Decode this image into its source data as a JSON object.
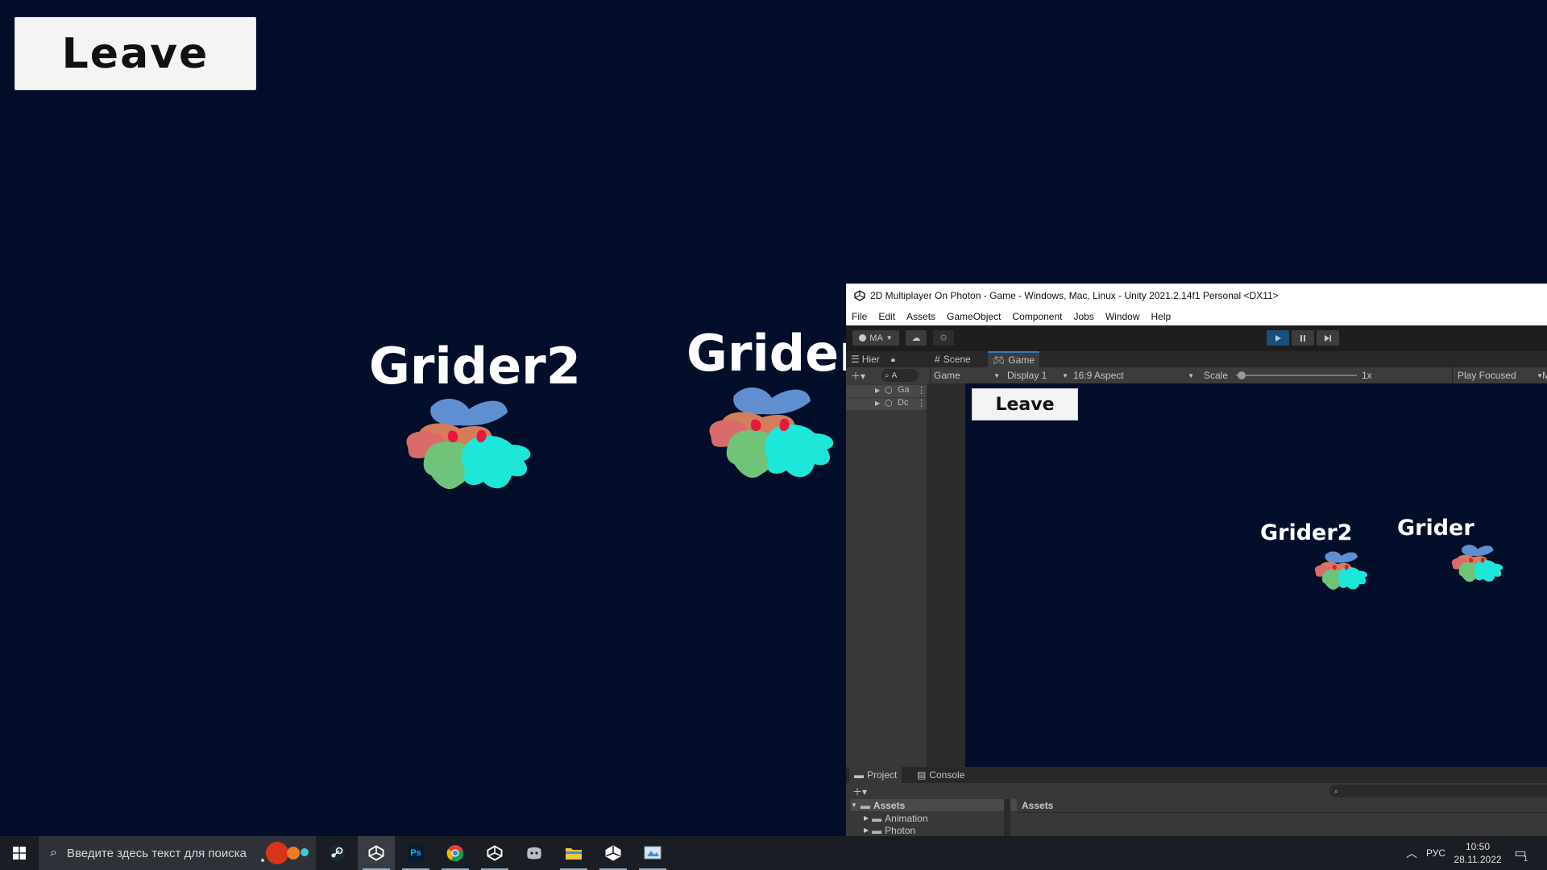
{
  "game": {
    "leave_label": "Leave",
    "players": [
      {
        "name": "Grider2"
      },
      {
        "name": "Grider"
      }
    ]
  },
  "unity": {
    "title": "2D Multiplayer On Photon - Game - Windows, Mac, Linux - Unity 2021.2.14f1 Personal <DX11>",
    "menu": [
      "File",
      "Edit",
      "Assets",
      "GameObject",
      "Component",
      "Jobs",
      "Window",
      "Help"
    ],
    "account_label": "MA",
    "tabs": {
      "hierarchy": "Hier",
      "scene": "Scene",
      "game": "Game"
    },
    "gamebar": {
      "mode": "Game",
      "display": "Display 1",
      "aspect": "16:9 Aspect",
      "scale_label": "Scale",
      "scale_value": "1x",
      "play_focused": "Play Focused",
      "overflow": "M"
    },
    "hierarchy_rows": [
      "Ga",
      "Dc"
    ],
    "search_placeholder_hier": "A",
    "bottom_tabs": {
      "project": "Project",
      "console": "Console"
    },
    "project_tree": {
      "root": "Assets",
      "children": [
        "Animation",
        "Photon"
      ]
    },
    "assets_breadcrumb": "Assets"
  },
  "taskbar": {
    "search_placeholder": "Введите здесь текст для поиска",
    "language": "РУС",
    "time": "10:50",
    "date": "28.11.2022",
    "notification_count": "1",
    "apps": [
      "steam-icon",
      "unity-hub-icon",
      "photoshop-icon",
      "chrome-icon",
      "unity-icon",
      "discord-icon",
      "file-explorer-icon",
      "unity-icon",
      "paint-icon"
    ]
  },
  "colors": {
    "game_background": "#020e2a",
    "unity_dark": "#383838",
    "play_active": "#1b4f75"
  }
}
